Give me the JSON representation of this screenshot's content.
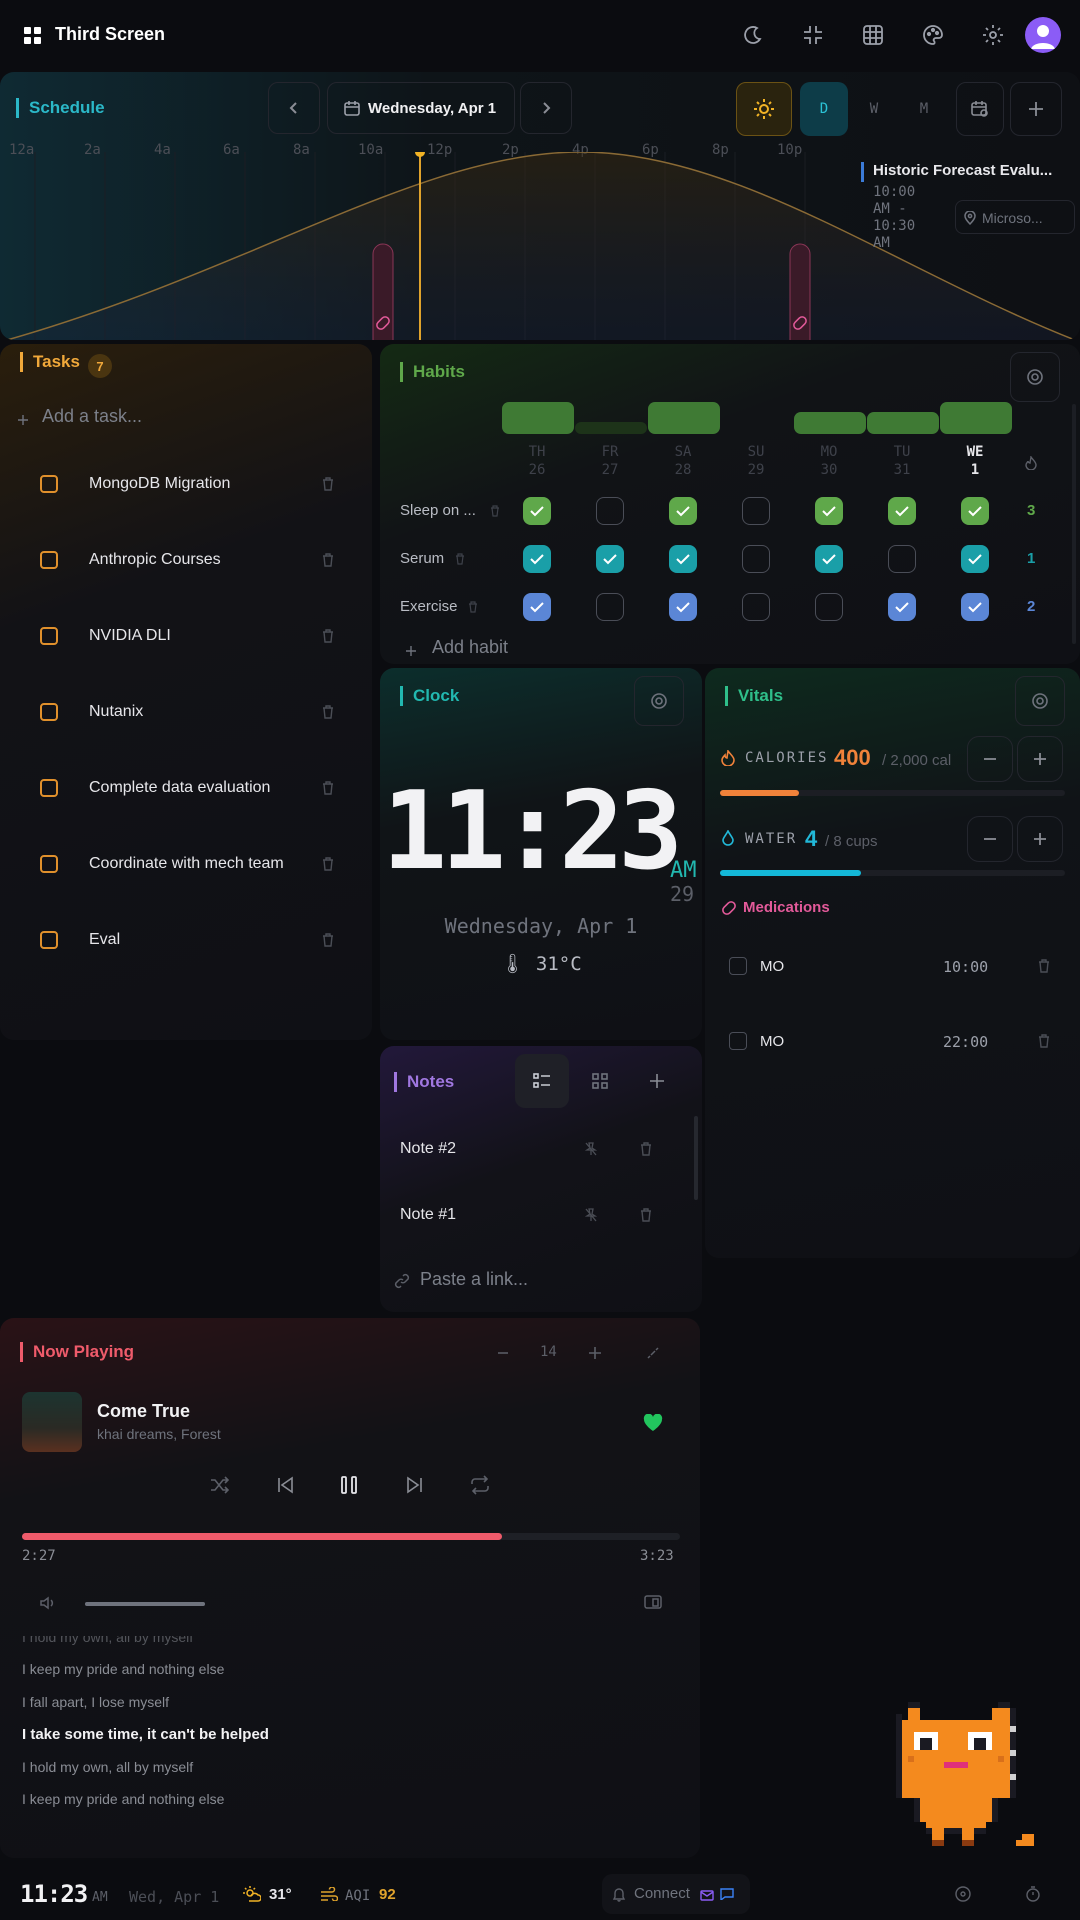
{
  "app": {
    "title": "Third Screen"
  },
  "schedule": {
    "title": "Schedule",
    "date": "Wednesday, Apr 1",
    "views": [
      "D",
      "W",
      "M"
    ],
    "hours": [
      "12a",
      "2a",
      "4a",
      "6a",
      "8a",
      "10a",
      "12p",
      "2p",
      "4p",
      "6p",
      "8p",
      "10p"
    ],
    "event": {
      "title": "Historic Forecast Evalu...",
      "time": "10:00 AM - 10:30 AM",
      "location": "Microso..."
    }
  },
  "tasks": {
    "title": "Tasks",
    "count": "7",
    "placeholder": "Add a task...",
    "items": [
      "MongoDB Migration",
      "Anthropic Courses",
      "NVIDIA DLI",
      "Nutanix",
      "Complete data evaluation",
      "Coordinate with mech team",
      "Eval"
    ]
  },
  "habits": {
    "title": "Habits",
    "days": [
      {
        "d": "TH",
        "n": "26"
      },
      {
        "d": "FR",
        "n": "27"
      },
      {
        "d": "SA",
        "n": "28"
      },
      {
        "d": "SU",
        "n": "29"
      },
      {
        "d": "MO",
        "n": "30"
      },
      {
        "d": "TU",
        "n": "31"
      },
      {
        "d": "WE",
        "n": "1"
      }
    ],
    "rows": [
      {
        "name": "Sleep on ...",
        "streak": "3",
        "color": "#5fa84a",
        "checks": [
          true,
          false,
          true,
          false,
          true,
          true,
          true
        ]
      },
      {
        "name": "Serum",
        "streak": "1",
        "color": "#1a9fa8",
        "checks": [
          true,
          true,
          true,
          false,
          true,
          false,
          true
        ]
      },
      {
        "name": "Exercise",
        "streak": "2",
        "color": "#5b86d6",
        "checks": [
          true,
          false,
          true,
          false,
          false,
          true,
          true
        ]
      }
    ],
    "add": "Add habit"
  },
  "clock": {
    "title": "Clock",
    "time": "11:23",
    "ampm": "AM",
    "seconds": "29",
    "date": "Wednesday, Apr 1",
    "temp": "31°C"
  },
  "vitals": {
    "title": "Vitals",
    "calories": {
      "label": "CALORIES",
      "value": "400",
      "goal": "/ 2,000 cal",
      "progress": 0.2
    },
    "water": {
      "label": "WATER",
      "value": "4",
      "goal": "/ 8 cups",
      "progress": 0.5
    },
    "meds_title": "Medications",
    "meds": [
      {
        "name": "MO",
        "time": "10:00"
      },
      {
        "name": "MO",
        "time": "22:00"
      }
    ]
  },
  "notes": {
    "title": "Notes",
    "items": [
      "Note #2",
      "Note #1"
    ],
    "placeholder": "Paste a link..."
  },
  "player": {
    "title": "Now Playing",
    "volume": "14",
    "track": "Come True",
    "artist": "khai dreams, Forest",
    "elapsed": "2:27",
    "total": "3:23",
    "progress": 0.73,
    "volume_level": 0.4,
    "lyrics": [
      "I hold my own, all by myself",
      "I keep my pride and nothing else",
      "I fall apart, I lose myself",
      "I take some time, it can't be helped",
      "I hold my own, all by myself",
      "I keep my pride and nothing else"
    ]
  },
  "statusbar": {
    "time": "11:23",
    "ampm": "AM",
    "date": "Wed, Apr 1",
    "temp": "31°",
    "aqi_label": "AQI",
    "aqi": "92",
    "connect": "Connect"
  },
  "colors": {
    "accent": "#e0a32c",
    "tasks": "#f0a83a",
    "habits": "#5fa84a",
    "clock": "#22b8b0",
    "vitals": "#2fbf8a",
    "notes": "#a077e0",
    "player": "#ef5b6b",
    "meds": "#e35a9a"
  }
}
